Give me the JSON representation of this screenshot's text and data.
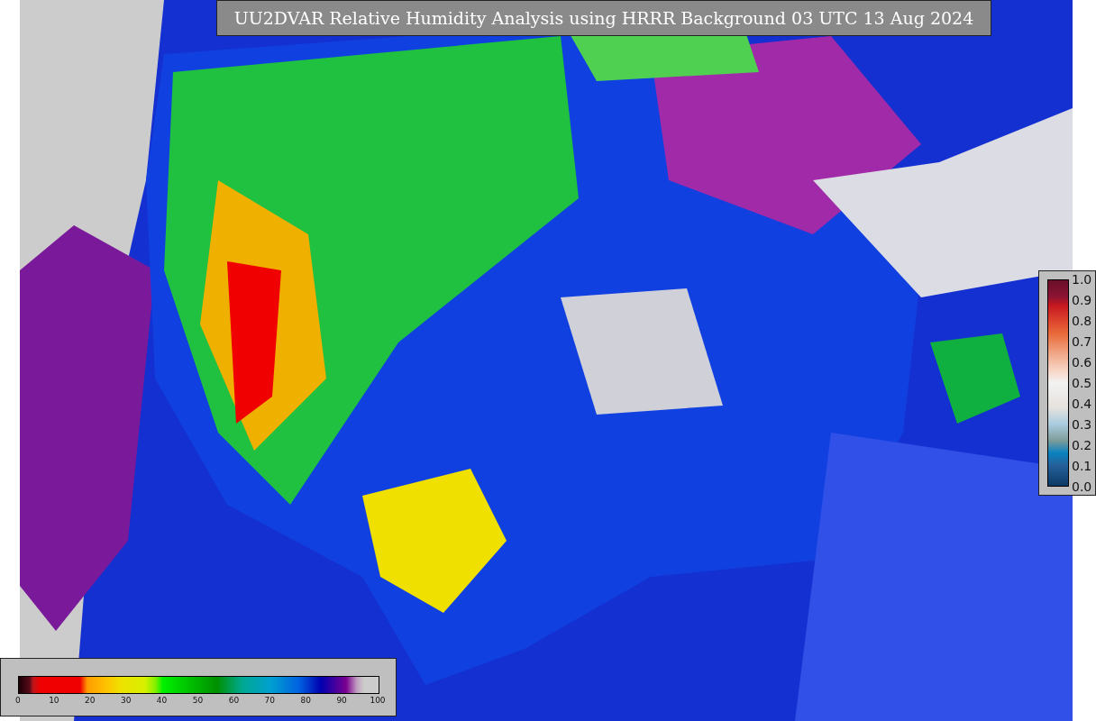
{
  "title": "UU2DVAR Relative Humidity Analysis using HRRR Background 03 UTC 13 Aug 2024",
  "error_legend": {
    "ticks": [
      "1.0",
      "0.9",
      "0.8",
      "0.7",
      "0.6",
      "0.5",
      "0.4",
      "0.3",
      "0.2",
      "0.1",
      "0.0"
    ]
  },
  "humidity_legend": {
    "ticks": [
      "0",
      "10",
      "20",
      "30",
      "40",
      "50",
      "60",
      "70",
      "80",
      "90",
      "100"
    ]
  }
}
